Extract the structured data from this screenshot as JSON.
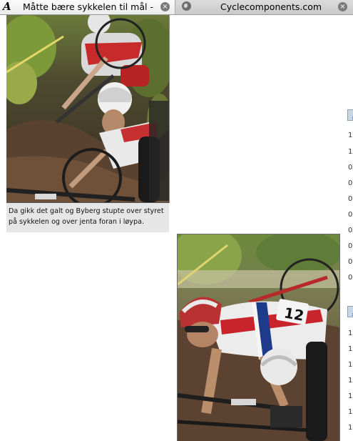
{
  "browser": {
    "tabs": [
      {
        "title": "Måtte bære sykkelen til mål - ...",
        "active": true,
        "favicon": "aftenposten-a-icon"
      },
      {
        "title": "Cyclecomponents.com",
        "active": false,
        "favicon": "globe-icon"
      }
    ],
    "close_glyph": "×"
  },
  "article": {
    "caption": "Da gikk det galt og Byberg stupte over styret på sykkelen og over jenta foran i løypa.",
    "photo_top_alt": "Two mountain bike riders, one falling over her handlebars",
    "photo_bottom_alt": "Rider number 12 in Norwegian jersey crashing among bikes"
  },
  "side_column": {
    "mark": "›",
    "group1": [
      "1",
      "1",
      "0",
      "0",
      "0",
      "0",
      "0",
      "0",
      "0",
      "0"
    ],
    "group2": [
      "1",
      "1",
      "1",
      "1",
      "1",
      "1",
      "1"
    ]
  }
}
